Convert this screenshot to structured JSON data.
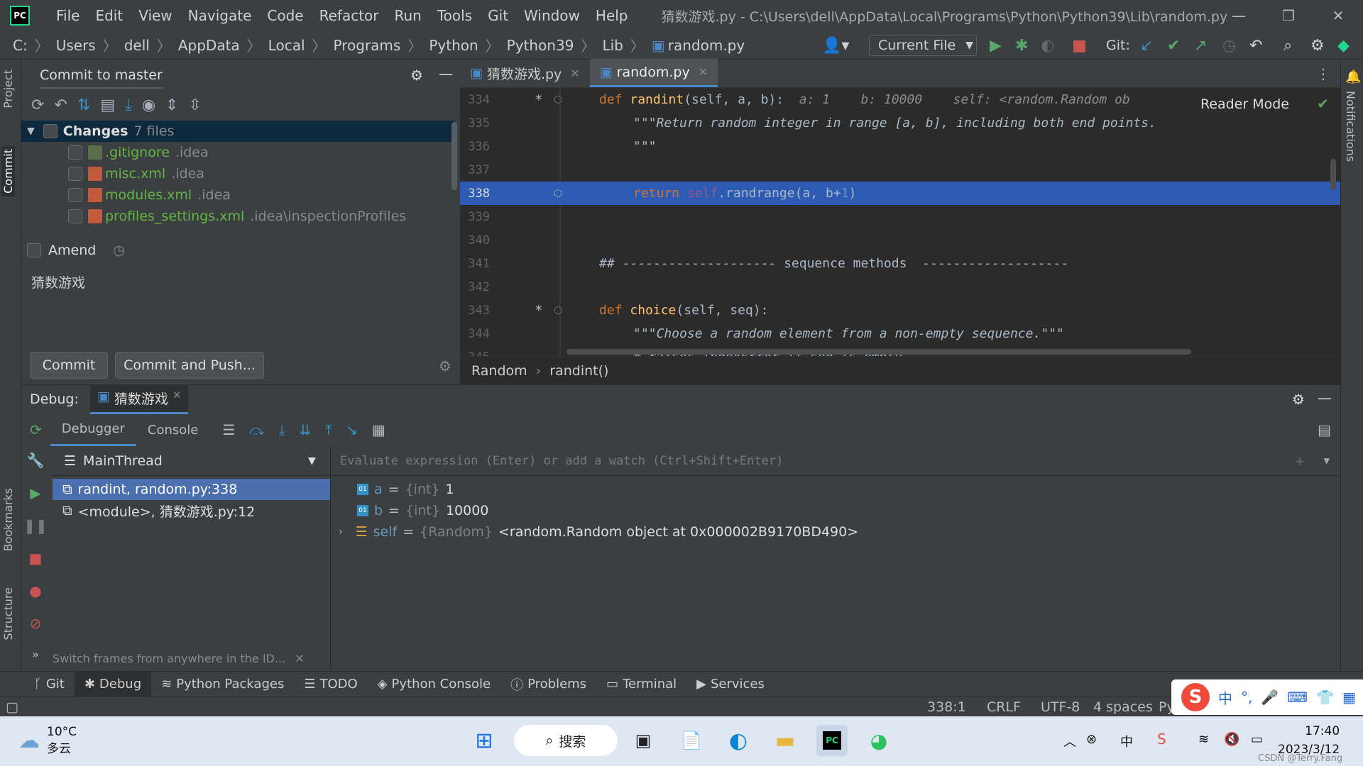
{
  "titlebar": {
    "menu": [
      "File",
      "Edit",
      "View",
      "Navigate",
      "Code",
      "Refactor",
      "Run",
      "Tools",
      "Git",
      "Window",
      "Help"
    ],
    "window_title": "猜数游戏.py - C:\\Users\\dell\\AppData\\Local\\Programs\\Python\\Python39\\Lib\\random.py",
    "minimize": "—",
    "restore": "❐",
    "close": "✕"
  },
  "navbar": {
    "crumbs": [
      "C:",
      "Users",
      "dell",
      "AppData",
      "Local",
      "Programs",
      "Python",
      "Python39",
      "Lib",
      "random.py"
    ],
    "run_config": "Current File",
    "git_label": "Git:"
  },
  "left_stripe": {
    "project": "Project",
    "commit": "Commit",
    "bookmarks": "Bookmarks",
    "structure": "Structure"
  },
  "right_stripe": {
    "notifications": "Notifications"
  },
  "commit_panel": {
    "title": "Commit to master",
    "changes_label": "Changes",
    "changes_count": "7 files",
    "files": [
      {
        "name": ".gitignore",
        "dir": ".idea"
      },
      {
        "name": "misc.xml",
        "dir": ".idea"
      },
      {
        "name": "modules.xml",
        "dir": ".idea"
      },
      {
        "name": "profiles_settings.xml",
        "dir": ".idea\\inspectionProfiles"
      }
    ],
    "amend_label": "Amend",
    "message": "猜数游戏",
    "commit_button": "Commit",
    "commit_push_button": "Commit and Push..."
  },
  "editor": {
    "tabs": [
      {
        "label": "猜数游戏.py",
        "active": false
      },
      {
        "label": "random.py",
        "active": true
      }
    ],
    "reader_mode": "Reader Mode",
    "lines": [
      {
        "n": "334"
      },
      {
        "n": "335"
      },
      {
        "n": "336"
      },
      {
        "n": "337"
      },
      {
        "n": "338"
      },
      {
        "n": "339"
      },
      {
        "n": "340"
      },
      {
        "n": "341"
      },
      {
        "n": "342"
      },
      {
        "n": "343"
      },
      {
        "n": "344"
      },
      {
        "n": "345"
      }
    ],
    "code": {
      "l334_def": "def ",
      "l334_fn": "randint",
      "l334_params": "(self, a, b):",
      "l334_hint": "  a: 1    b: 10000    self: <random.Random ob",
      "l335": "\"\"\"Return random integer in range [a, b], including both end points.",
      "l336": "\"\"\"",
      "l338_ret": "return ",
      "l338_self": "self",
      "l338_rest": ".randrange(a, b+",
      "l338_num": "1",
      "l338_close": ")",
      "l341": "## -------------------- sequence methods  -------------------",
      "l343_def": "def ",
      "l343_fn": "choice",
      "l343_params": "(self, seq):",
      "l344": "\"\"\"Choose a random element from a non-empty sequence.\"\"\"",
      "l345": "# raises IndexError if seq is empty"
    },
    "breadcrumb": [
      "Random",
      "randint()"
    ]
  },
  "debug": {
    "label": "Debug:",
    "session": "猜数游戏",
    "tabs": [
      "Debugger",
      "Console"
    ],
    "thread": "MainThread",
    "frames": [
      {
        "label": "randint, random.py:338",
        "selected": true
      },
      {
        "label": "<module>, 猜数游戏.py:12",
        "selected": false
      }
    ],
    "switch_hint": "Switch frames from anywhere in the ID...",
    "eval_placeholder": "Evaluate expression (Enter) or add a watch (Ctrl+Shift+Enter)",
    "variables": [
      {
        "name": "a",
        "type": "{int}",
        "value": "1"
      },
      {
        "name": "b",
        "type": "{int}",
        "value": "10000"
      },
      {
        "name": "self",
        "type": "{Random}",
        "value": "<random.Random object at 0x000002B9170BD490>"
      }
    ]
  },
  "bottom_tabs": [
    "Git",
    "Debug",
    "Python Packages",
    "TODO",
    "Python Console",
    "Problems",
    "Terminal",
    "Services"
  ],
  "statusbar": {
    "position": "338:1",
    "line_sep": "CRLF",
    "encoding": "UTF-8",
    "indent": "4 spaces",
    "interpreter": "Python"
  },
  "taskbar": {
    "temp": "10°C",
    "weather": "多云",
    "search": "搜索",
    "time": "17:40",
    "date": "2023/3/12",
    "watermark": "CSDN @Terry.Fang"
  },
  "ime": {
    "zh": "中"
  },
  "colors": {
    "accent": "#4a88c7",
    "selection": "#4b6eaf",
    "editor_bg": "#2b2b2b",
    "panel_bg": "#3c3f41",
    "green": "#62b543"
  }
}
